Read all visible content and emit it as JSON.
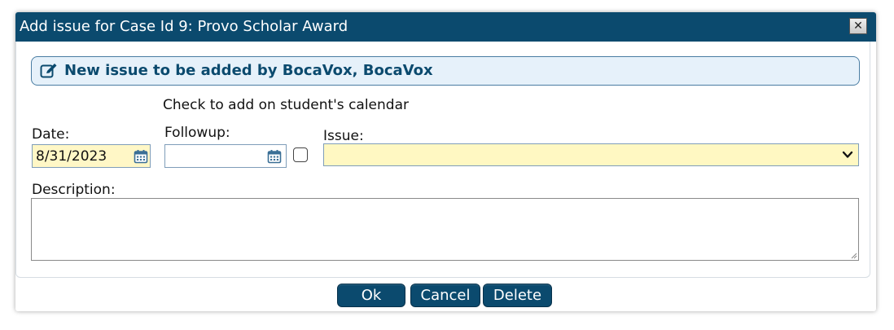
{
  "dialog": {
    "title": "Add issue for Case Id 9: Provo Scholar Award",
    "close_icon": "close-icon"
  },
  "header": {
    "text": "New issue to be added by BocaVox, BocaVox",
    "icon": "edit-icon"
  },
  "form": {
    "calendar_note": "Check to add on student's calendar",
    "date_label": "Date:",
    "date_value": "8/31/2023",
    "followup_label": "Followup:",
    "followup_value": "",
    "calendar_checkbox_checked": false,
    "issue_label": "Issue:",
    "issue_value": "",
    "description_label": "Description:",
    "description_value": ""
  },
  "buttons": {
    "ok": "Ok",
    "cancel": "Cancel",
    "delete": "Delete"
  },
  "colors": {
    "titlebar": "#0b4a6e",
    "accent": "#0b4a6e",
    "required_field_bg": "#fff7c6",
    "header_bg": "#e6f1fa"
  }
}
